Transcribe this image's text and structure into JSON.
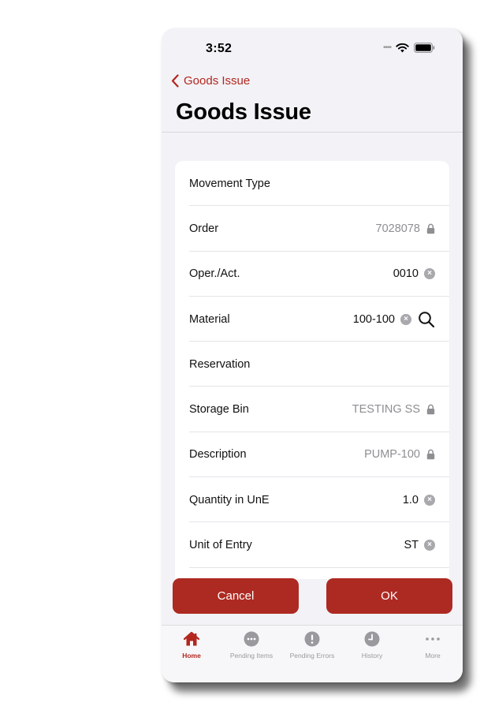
{
  "status_bar": {
    "time": "3:52",
    "signal_dots": "••••"
  },
  "nav": {
    "back_label": "Goods Issue",
    "title": "Goods Issue"
  },
  "form": {
    "rows": [
      {
        "label": "Movement Type",
        "value": ""
      },
      {
        "label": "Order",
        "value": "7028078"
      },
      {
        "label": "Oper./Act.",
        "value": "0010"
      },
      {
        "label": "Material",
        "value": "100-100"
      },
      {
        "label": "Reservation",
        "value": ""
      },
      {
        "label": "Storage Bin",
        "value": "TESTING SS"
      },
      {
        "label": "Description",
        "value": "PUMP-100"
      },
      {
        "label": "Quantity in UnE",
        "value": "1.0"
      },
      {
        "label": "Unit of Entry",
        "value": "ST"
      }
    ]
  },
  "buttons": {
    "cancel": "Cancel",
    "ok": "OK"
  },
  "tabbar": {
    "tabs": [
      {
        "label": "Home",
        "icon": "home-icon"
      },
      {
        "label": "Pending Items",
        "icon": "ellipsis-circle-icon"
      },
      {
        "label": "Pending Errors",
        "icon": "exclamation-circle-icon"
      },
      {
        "label": "History",
        "icon": "clock-icon"
      },
      {
        "label": "More",
        "icon": "more-dots-icon"
      }
    ]
  },
  "colors": {
    "accent": "#b3261e",
    "button": "#ad2a22",
    "background": "#f2f2f7"
  }
}
